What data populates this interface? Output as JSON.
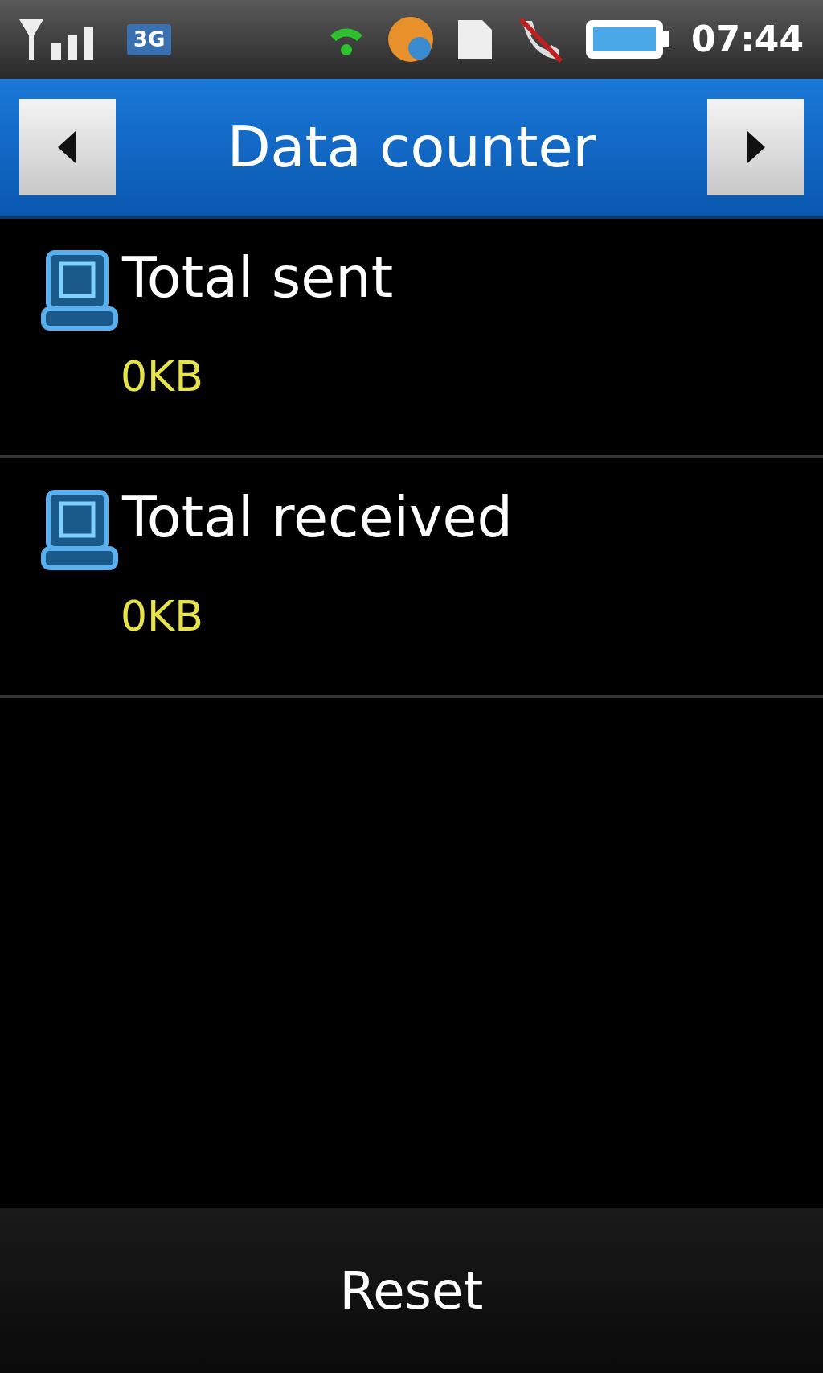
{
  "status_bar": {
    "network": "3G",
    "time": "07:44"
  },
  "header": {
    "title": "Data counter"
  },
  "items": [
    {
      "label": "Total sent",
      "value": "0KB"
    },
    {
      "label": "Total received",
      "value": "0KB"
    }
  ],
  "footer": {
    "button": "Reset"
  }
}
